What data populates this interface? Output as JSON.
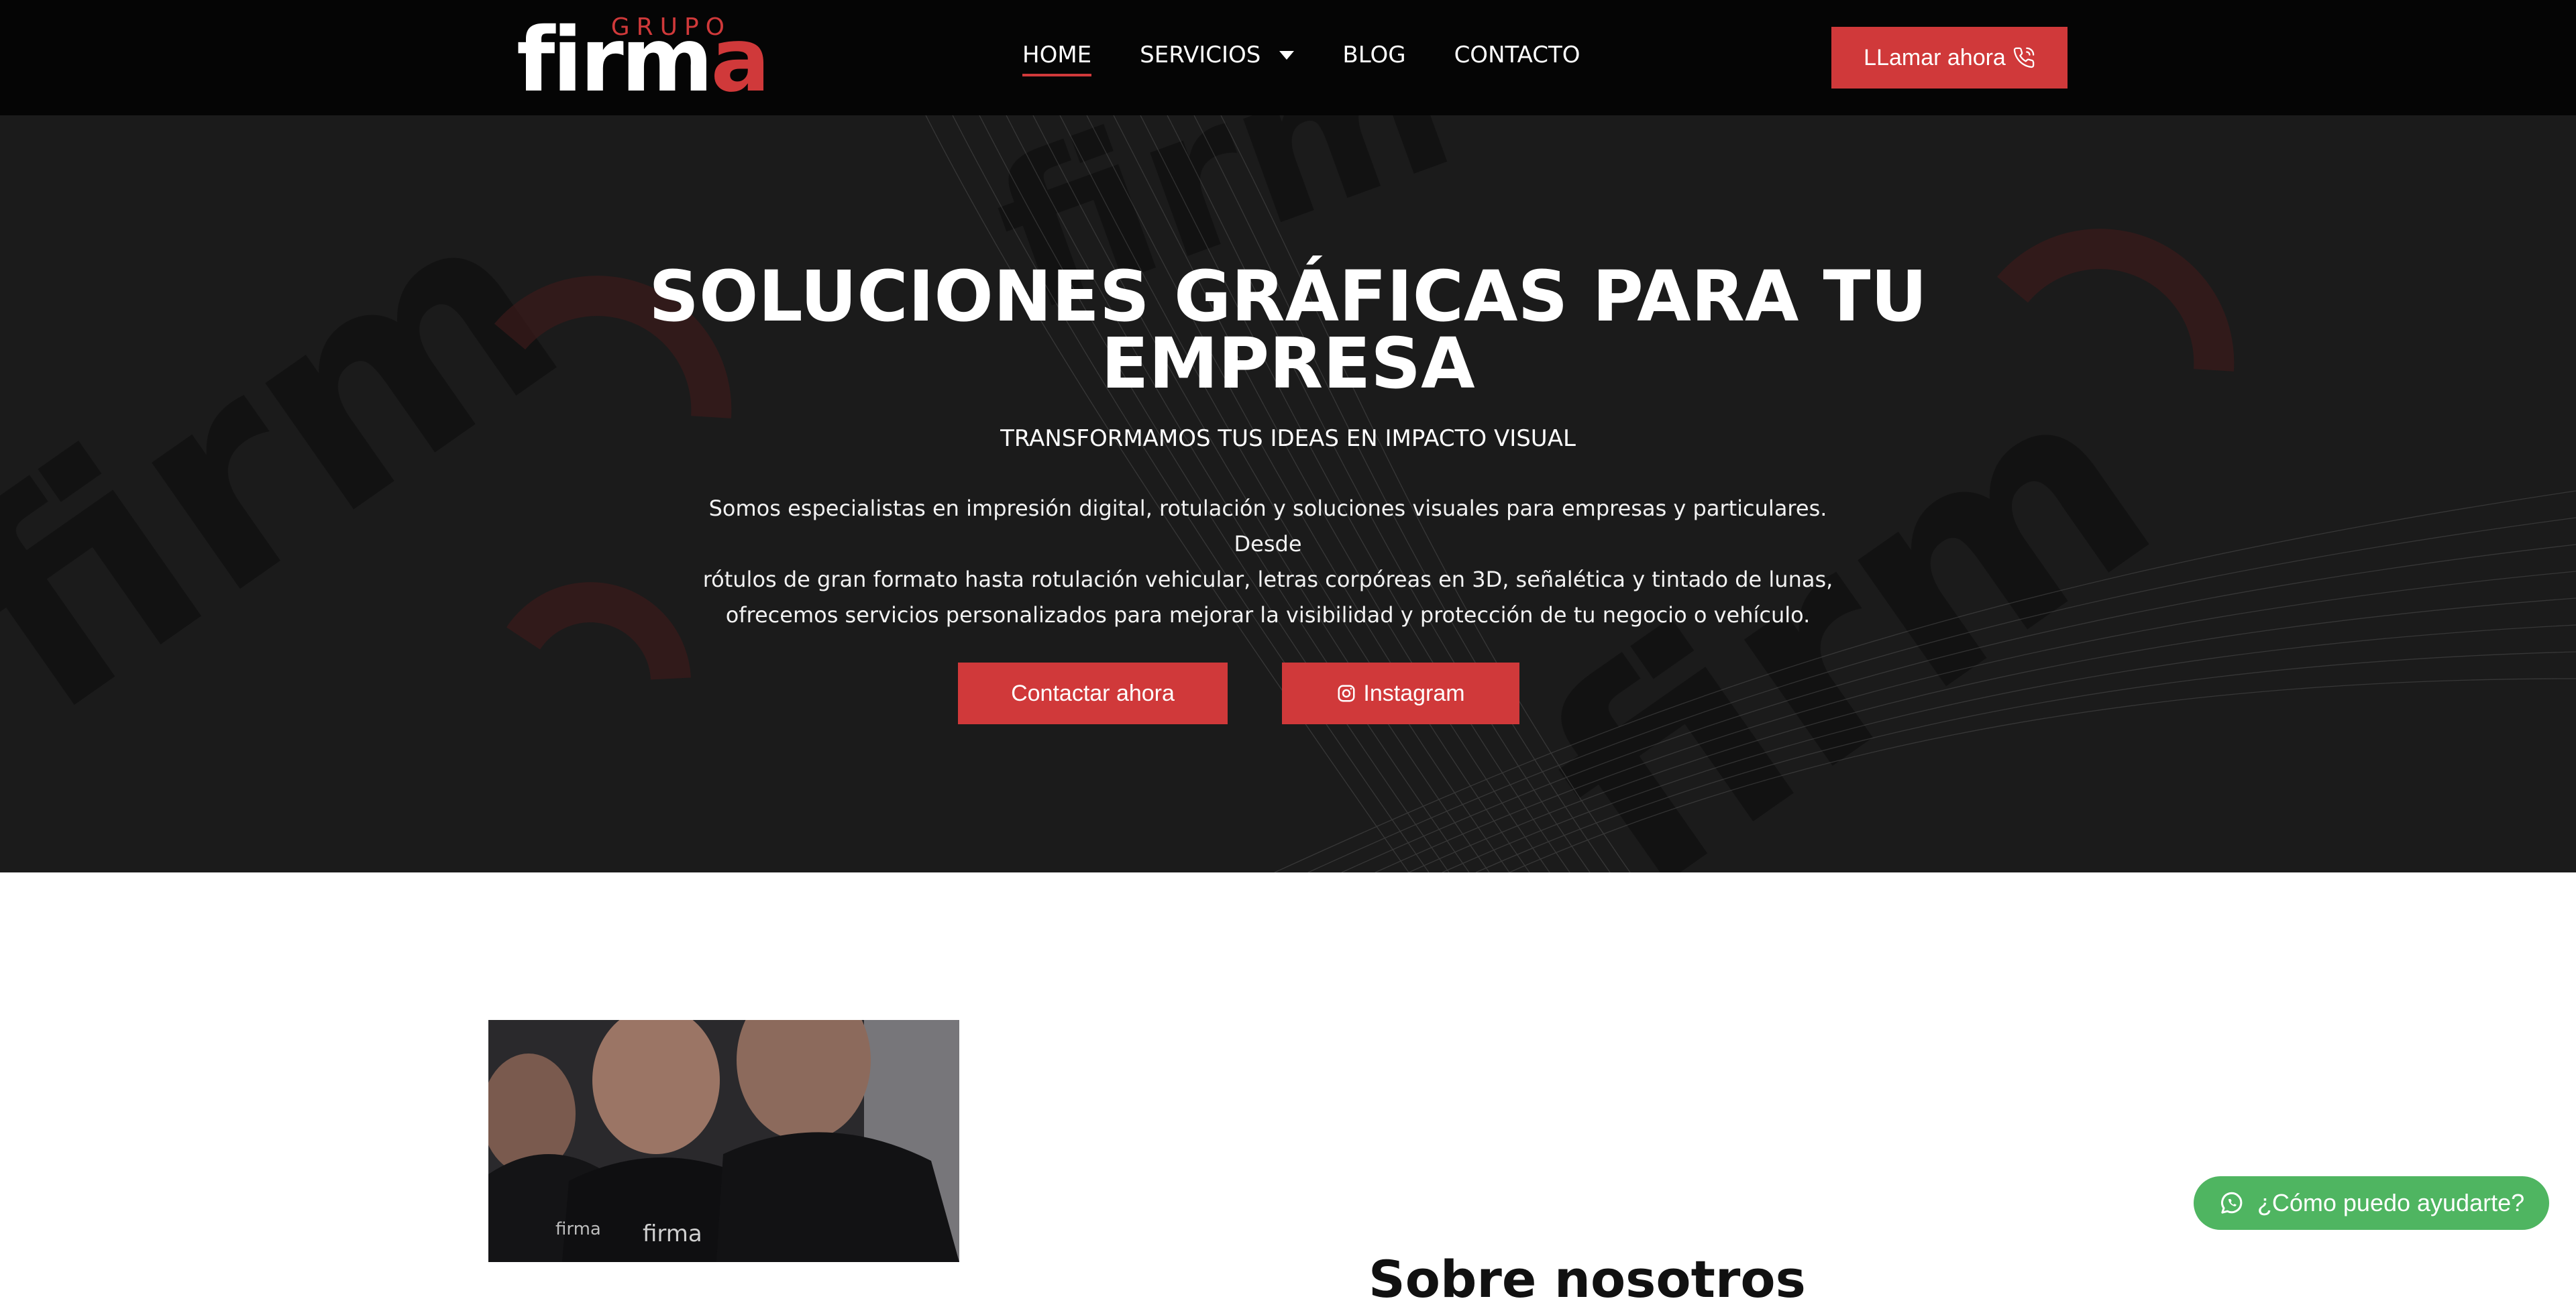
{
  "header": {
    "logo": {
      "top_text": "GRUPO",
      "main_text": "firma",
      "main_accent": "a"
    },
    "nav": [
      {
        "label": "HOME",
        "active": true
      },
      {
        "label": "SERVICIOS",
        "has_dropdown": true
      },
      {
        "label": "BLOG"
      },
      {
        "label": "CONTACTO"
      }
    ],
    "call_button": {
      "label": "LLamar ahora",
      "icon": "phone-icon"
    }
  },
  "hero": {
    "title_line1": "SOLUCIONES GRÁFICAS PARA TU",
    "title_line2": "EMPRESA",
    "subtitle": "TRANSFORMAMOS TUS IDEAS EN IMPACTO VISUAL",
    "description_line1": "Somos especialistas en impresión digital, rotulación y soluciones visuales para empresas y particulares. Desde",
    "description_line2": "rótulos de gran formato hasta rotulación vehicular, letras corpóreas en 3D, señalética y tintado de lunas,",
    "description_line3": "ofrecemos servicios personalizados para mejorar la visibilidad y protección de tu negocio o vehículo.",
    "buttons": {
      "contact": "Contactar ahora",
      "instagram": "Instagram"
    }
  },
  "about": {
    "title": "Sobre nosotros"
  },
  "whatsapp": {
    "label": "¿Cómo puedo ayudarte?",
    "icon": "whatsapp-icon"
  },
  "colors": {
    "brand_red": "#d0393a",
    "header_bg": "#050505",
    "whatsapp_green": "#4fb561"
  }
}
